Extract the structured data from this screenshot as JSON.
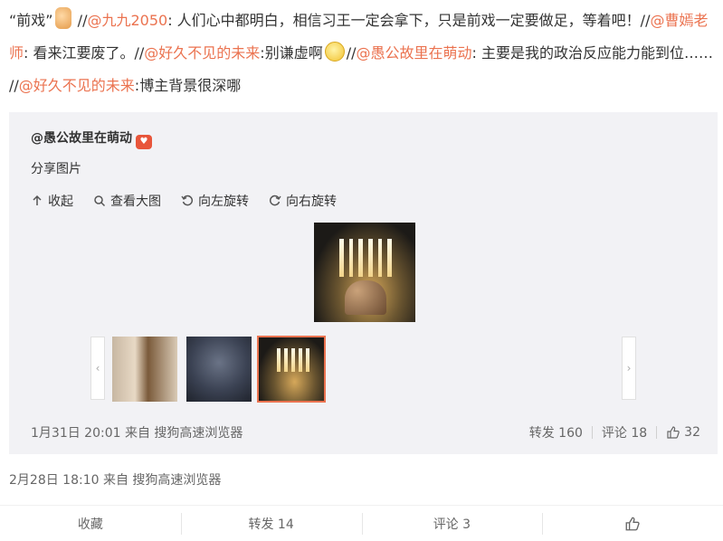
{
  "post": {
    "segments": [
      {
        "type": "text",
        "value": "“前戏”"
      },
      {
        "type": "icon",
        "name": "thumbs-up-emoji-icon"
      },
      {
        "type": "text",
        "value": " //"
      },
      {
        "type": "mention",
        "value": "@九九2050"
      },
      {
        "type": "text",
        "value": ": 人们心中都明白，相信习王一定会拿下，只是前戏一定要做足，等着吧！//"
      },
      {
        "type": "mention",
        "value": "@曹嫣老师"
      },
      {
        "type": "text",
        "value": ": 看来江要废了。//"
      },
      {
        "type": "mention",
        "value": "@好久不见的未来"
      },
      {
        "type": "text",
        "value": ":别谦虚啊"
      },
      {
        "type": "icon",
        "name": "smiling-face-emoji-icon"
      },
      {
        "type": "text",
        "value": "//"
      },
      {
        "type": "mention",
        "value": "@愚公故里在萌动"
      },
      {
        "type": "text",
        "value": ": 主要是我的政治反应能力能到位…… //"
      },
      {
        "type": "mention",
        "value": "@好久不见的未来"
      },
      {
        "type": "text",
        "value": ":博主背景很深哪"
      }
    ]
  },
  "repost": {
    "author": "@愚公故里在萌动",
    "text": "分享图片",
    "tools": {
      "collapse": "收起",
      "view_large": "查看大图",
      "rotate_left": "向左旋转",
      "rotate_right": "向右旋转"
    },
    "footer": {
      "time_source": "1月31日 20:01 来自 搜狗高速浏览器",
      "repost": "转发 160",
      "comment": "评论 18",
      "likes": "32"
    }
  },
  "meta": {
    "time_source": "2月28日 18:10 来自 搜狗高速浏览器"
  },
  "actions": {
    "favorite": "收藏",
    "repost": "转发 14",
    "comment": "评论 3"
  },
  "colors": {
    "mention": "#eb7350",
    "repost_bg": "#f2f2f5",
    "selected_border": "#eb7350"
  }
}
